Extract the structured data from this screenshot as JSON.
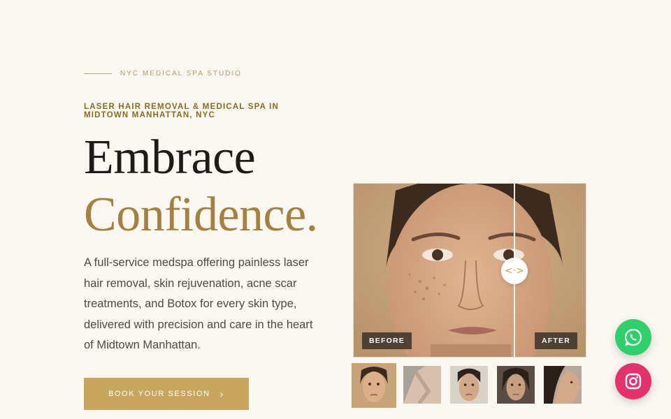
{
  "hero": {
    "eyebrow": "NYC MEDICAL SPA STUDIO",
    "subheading": "LASER HAIR REMOVAL & MEDICAL SPA IN MIDTOWN MANHATTAN, NYC",
    "title_line1": "Embrace",
    "title_line2": "Confidence.",
    "description": "A full-service medspa offering painless laser hair removal, skin rejuvenation, acne scar treatments, and Botox for every skin type, delivered with precision and care in the heart of Midtown Manhattan.",
    "cta_label": "BOOK YOUR SESSION",
    "cta_icon": "chevron-right-icon"
  },
  "comparison": {
    "before_label": "BEFORE",
    "after_label": "AFTER",
    "handle_icon": "arrows-left-right-icon",
    "handle_glyph": "<·>",
    "slider_position": 0.69
  },
  "thumbnails": [
    {
      "name": "face-front",
      "active": true
    },
    {
      "name": "underarm",
      "active": false
    },
    {
      "name": "face-front-2",
      "active": false
    },
    {
      "name": "face-front-3",
      "active": false
    },
    {
      "name": "face-profile",
      "active": false
    }
  ],
  "social": {
    "whatsapp_icon": "whatsapp-icon",
    "instagram_icon": "instagram-icon"
  },
  "colors": {
    "background": "#fbf7f1",
    "accent_gold": "#c8a65e",
    "title_gold": "#a5803f",
    "whatsapp": "#2fcf6a",
    "instagram": "#e4326c"
  }
}
